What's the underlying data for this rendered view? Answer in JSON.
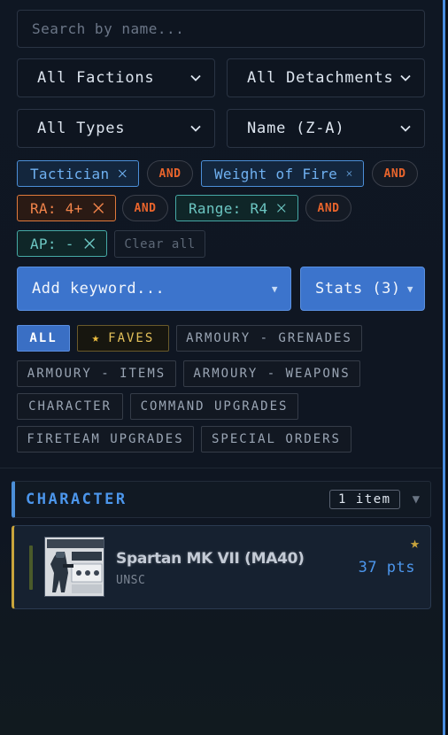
{
  "search": {
    "placeholder": "Search by name..."
  },
  "filters": {
    "faction": "All Factions",
    "detachment": "All Detachments",
    "type": "All Types",
    "sort": "Name (Z-A)"
  },
  "active_filters": {
    "chips": [
      {
        "label": "Tactician",
        "color": "#4c8fd8"
      },
      {
        "label": "Weight of Fire",
        "color": "#4c8fd8"
      },
      {
        "label": "RA: 4+",
        "color": "#e07a3c"
      },
      {
        "label": "Range: R4",
        "color": "#46a9a6"
      },
      {
        "label": "AP: -",
        "color": "#46a9a6"
      }
    ],
    "operator": "AND",
    "clear_label": "Clear all"
  },
  "keyword_button": {
    "label": "Add keyword...",
    "icon": "triangle-down-icon"
  },
  "stats_button": {
    "label": "Stats (3)",
    "icon": "triangle-down-icon"
  },
  "categories": [
    {
      "label": "ALL",
      "active": true
    },
    {
      "label": "FAVES",
      "icon": "star-icon"
    },
    {
      "label": "ARMOURY - GRENADES"
    },
    {
      "label": "ARMOURY - ITEMS"
    },
    {
      "label": "ARMOURY - WEAPONS"
    },
    {
      "label": "CHARACTER"
    },
    {
      "label": "COMMAND UPGRADES"
    },
    {
      "label": "FIRETEAM UPGRADES"
    },
    {
      "label": "SPECIAL ORDERS"
    }
  ],
  "section": {
    "title": "CHARACTER",
    "count": "1 item",
    "items": [
      {
        "name": "Spartan MK VII (MA40)",
        "faction": "UNSC",
        "points": "37 pts",
        "favorite": true
      }
    ]
  },
  "colors": {
    "accent": "#4c8fd8",
    "favorite": "#c8a43c",
    "operator": "#e8642c"
  }
}
